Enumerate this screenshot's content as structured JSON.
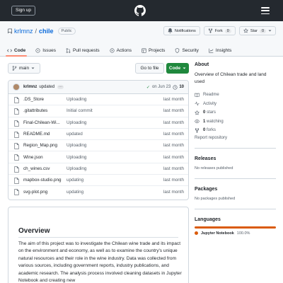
{
  "header": {
    "signup_label": "Sign up",
    "menu_icon": "hamburger-icon",
    "logo_icon": "github-logo-icon"
  },
  "repo": {
    "owner": "krlmnz",
    "separator": "/",
    "name": "chile",
    "visibility": "Public",
    "notifications_label": "Notifications",
    "fork_label": "Fork",
    "fork_count": "0",
    "star_label": "Star",
    "star_count": "0"
  },
  "tabs": [
    {
      "label": "Code",
      "icon": "code-icon",
      "active": true
    },
    {
      "label": "Issues",
      "icon": "issue-icon"
    },
    {
      "label": "Pull requests",
      "icon": "pull-request-icon"
    },
    {
      "label": "Actions",
      "icon": "play-icon"
    },
    {
      "label": "Projects",
      "icon": "table-icon"
    },
    {
      "label": "Security",
      "icon": "shield-icon"
    },
    {
      "label": "Insights",
      "icon": "graph-icon"
    }
  ],
  "toolbar": {
    "branch": "main",
    "goto_file": "Go to file",
    "code_button": "Code"
  },
  "commit": {
    "author": "krlmnz",
    "message": "updated",
    "ellipsis": "···",
    "check": "✓",
    "date": "on Jun 23",
    "count": "10"
  },
  "files": [
    {
      "name": ".DS_Store",
      "message": "Uploading",
      "time": "last month"
    },
    {
      "name": ".gitattributes",
      "message": "Initial commit",
      "time": "last month"
    },
    {
      "name": "Final-Chilean-Wi...",
      "message": "Uploading",
      "time": "last month"
    },
    {
      "name": "README.md",
      "message": "updated",
      "time": "last month"
    },
    {
      "name": "Region_Map.png",
      "message": "Uploading",
      "time": "last month"
    },
    {
      "name": "Wine.json",
      "message": "Uploading",
      "time": "last month"
    },
    {
      "name": "ch_wines.csv",
      "message": "Uploading",
      "time": "last month"
    },
    {
      "name": "mapbox-studio.png",
      "message": "updating",
      "time": "last month"
    },
    {
      "name": "svg-plot.png",
      "message": "updating",
      "time": "last month"
    }
  ],
  "readme": {
    "heading": "Overview",
    "body": "The aim of this project was to investigate the Chilean wine trade and its impact on the environment and economy, as well as to examine the country's unique natural resources and their role in the wine industry. Data was collected from various sources, including government reports, industry publications, and academic research. The analysis process involved cleaning datasets in Jupyter Notebook and creating new"
  },
  "about": {
    "title": "About",
    "description": "Overview of Chilean trade and land used",
    "readme_label": "Readme",
    "activity_label": "Activity",
    "stars_count": "0",
    "stars_label": "stars",
    "watching_count": "1",
    "watching_label": "watching",
    "forks_count": "0",
    "forks_label": "forks",
    "report_label": "Report repository"
  },
  "releases": {
    "title": "Releases",
    "empty": "No releases published"
  },
  "packages": {
    "title": "Packages",
    "empty": "No packages published"
  },
  "languages": {
    "title": "Languages",
    "items": [
      {
        "name": "Jupyter Notebook",
        "percent": "100.0%",
        "color": "#da5b0b"
      }
    ]
  }
}
